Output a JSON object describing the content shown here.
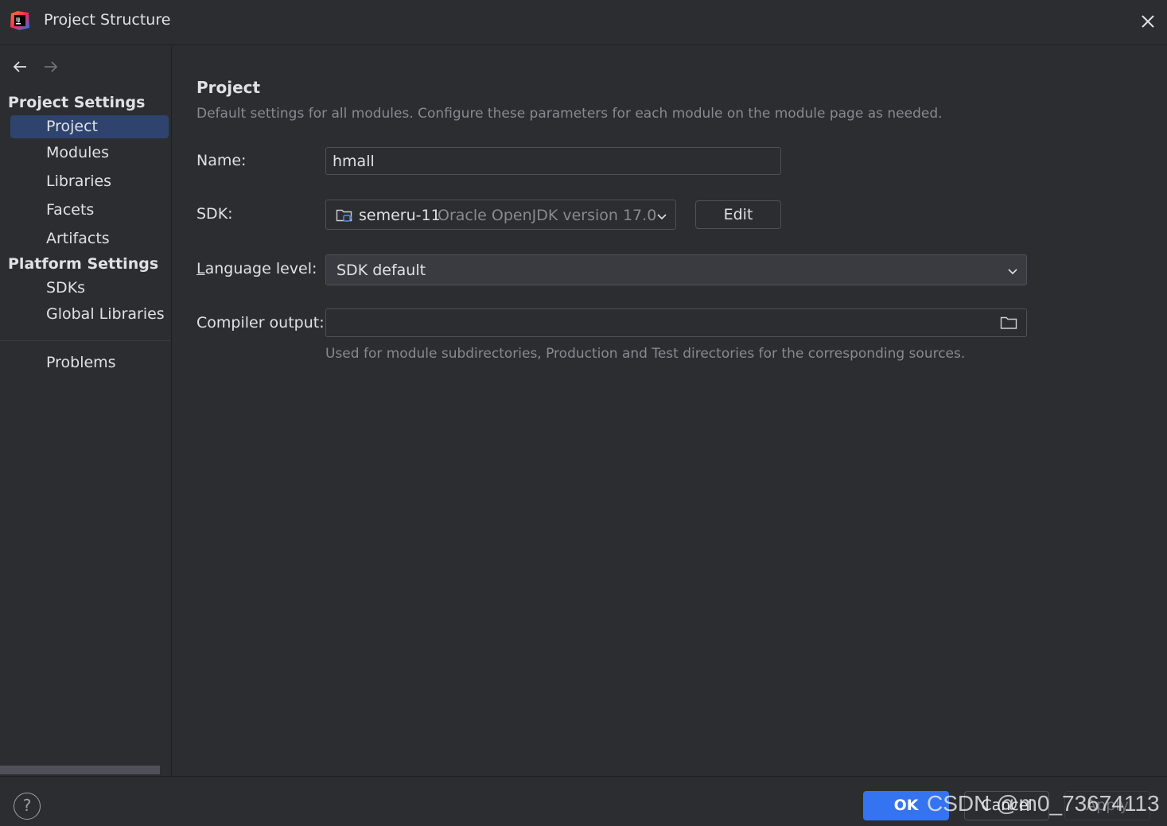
{
  "window": {
    "title": "Project Structure",
    "logo_icon": "intellij-idea-icon",
    "close_icon": "close-icon"
  },
  "sidebar": {
    "back_icon": "arrow-left-icon",
    "forward_icon": "arrow-right-icon",
    "sections": [
      {
        "header": "Project Settings",
        "items": [
          {
            "label": "Project",
            "selected": true
          },
          {
            "label": "Modules"
          },
          {
            "label": "Libraries"
          },
          {
            "label": "Facets"
          },
          {
            "label": "Artifacts"
          }
        ]
      },
      {
        "header": "Platform Settings",
        "items": [
          {
            "label": "SDKs"
          },
          {
            "label": "Global Libraries"
          }
        ]
      }
    ],
    "problems_label": "Problems"
  },
  "main": {
    "title": "Project",
    "description": "Default settings for all modules. Configure these parameters for each module on the module page as needed.",
    "name": {
      "label": "Name:",
      "value": "hmall"
    },
    "sdk": {
      "label": "SDK:",
      "name": "semeru-11",
      "version": "Oracle OpenJDK version 17.0",
      "edit_label": "Edit"
    },
    "language_level": {
      "label_first": "L",
      "label_rest": "anguage level:",
      "value": "SDK default"
    },
    "compiler_output": {
      "label": "Compiler output:",
      "value": "",
      "hint": "Used for module subdirectories, Production and Test directories for the corresponding sources."
    }
  },
  "footer": {
    "help_label": "?",
    "ok_label": "OK",
    "cancel_label": "Cancel",
    "apply_label": "Apply",
    "watermark": "CSDN @m0_73674113"
  },
  "colors": {
    "background": "#2b2d30",
    "selection": "#2e436e",
    "primary_button": "#3574f0",
    "muted_text": "#868a91"
  }
}
